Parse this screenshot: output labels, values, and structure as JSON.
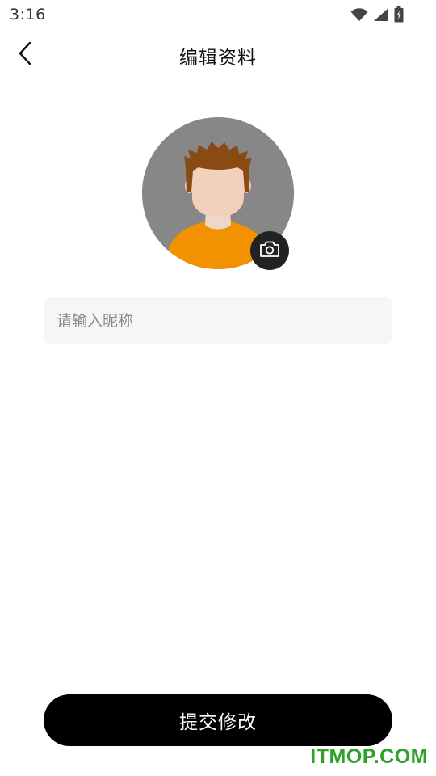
{
  "status_bar": {
    "time": "3:16",
    "icons": [
      "wifi-icon",
      "cellular-signal-icon",
      "battery-charging-icon"
    ]
  },
  "header": {
    "title": "编辑资料",
    "back_icon": "chevron-left-icon"
  },
  "profile": {
    "avatar_icon": "default-avatar-illustration",
    "camera_icon": "camera-icon"
  },
  "nickname": {
    "placeholder": "请输入昵称",
    "value": ""
  },
  "actions": {
    "submit_label": "提交修改"
  },
  "watermark": {
    "text": "ITMOP.COM"
  },
  "colors": {
    "background": "#ffffff",
    "input_background": "#f5f6f8",
    "button_background": "#000000",
    "button_text": "#ffffff",
    "avatar_background": "#878787",
    "avatar_shirt": "#f39200",
    "avatar_hair": "#8a4a14",
    "watermark": "#2fa12a"
  }
}
